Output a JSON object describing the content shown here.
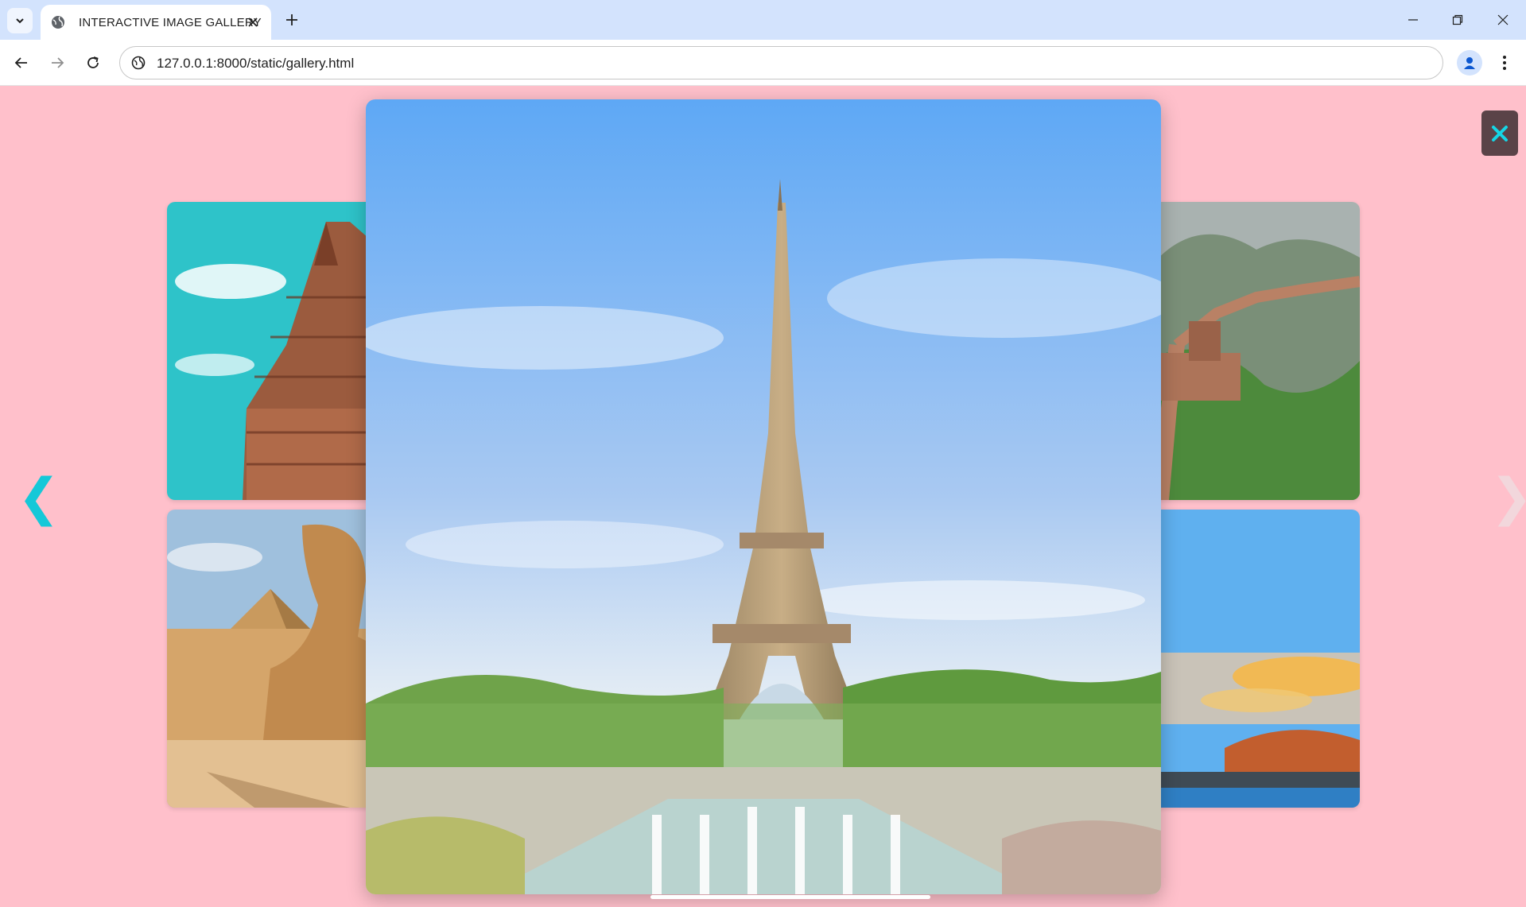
{
  "browser": {
    "tab_title": "INTERACTIVE IMAGE GALLERY",
    "url": "127.0.0.1:8000/static/gallery.html",
    "accent_color": "#d3e3fd"
  },
  "gallery": {
    "background_color": "#ffc0cb",
    "prev_arrow": "❮",
    "next_arrow": "❯",
    "close_label": "✕",
    "arrow_color": "#15c8d8",
    "thumbnails": [
      {
        "subject": "temple"
      },
      {
        "subject": "great-wall"
      },
      {
        "subject": "sphinx-pyramid"
      },
      {
        "subject": "harbor-sunset"
      }
    ],
    "main_image": {
      "subject": "eiffel-tower"
    }
  }
}
